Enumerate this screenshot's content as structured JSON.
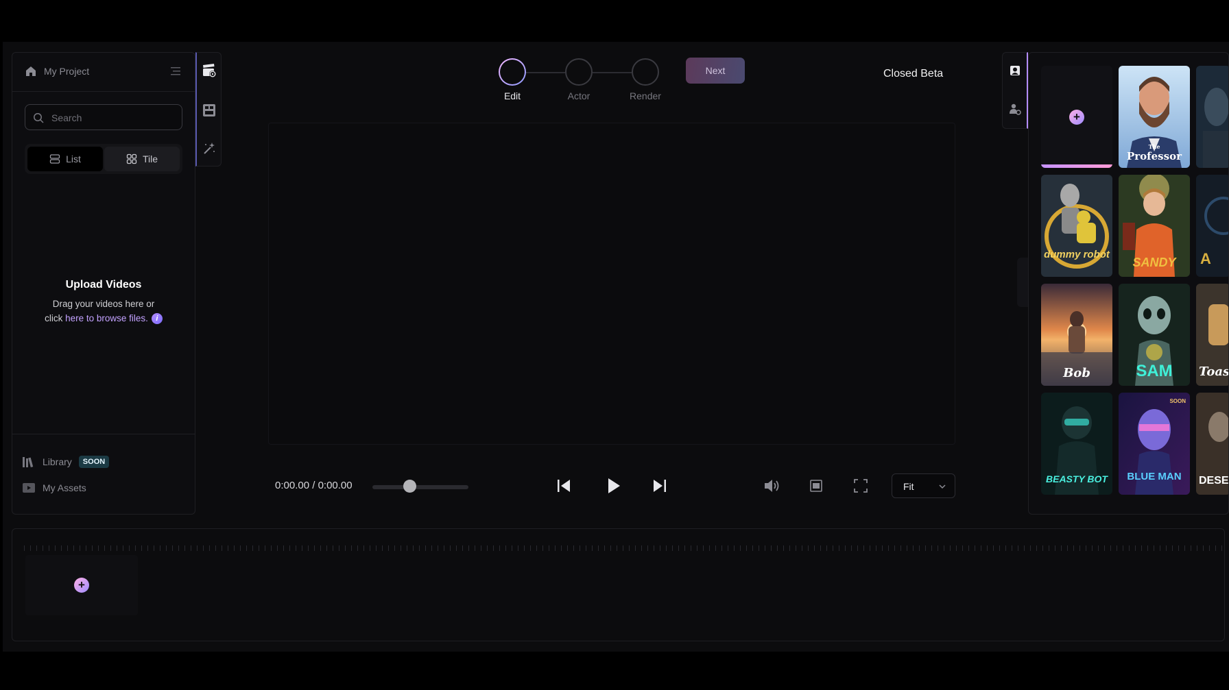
{
  "project": {
    "title": "My Project"
  },
  "search": {
    "placeholder": "Search"
  },
  "view_toggle": {
    "list_label": "List",
    "tile_label": "Tile"
  },
  "upload": {
    "title": "Upload Videos",
    "line1": "Drag your videos here or",
    "line2_prefix": "click ",
    "link_text": "here to browse files.",
    "info_icon": "i"
  },
  "library": {
    "label": "Library",
    "badge": "SOON"
  },
  "assets": {
    "label": "My Assets"
  },
  "stepper": {
    "steps": [
      {
        "label": "Edit",
        "active": true
      },
      {
        "label": "Actor",
        "active": false
      },
      {
        "label": "Render",
        "active": false
      }
    ],
    "next_label": "Next"
  },
  "beta_label": "Closed Beta",
  "player": {
    "current_time": "0:00.00",
    "separator": "/",
    "total_time": "0:00.00",
    "scrub_position": 0.39,
    "fit_value": "Fit"
  },
  "actors": {
    "cards": [
      {
        "name": "The Professor",
        "display_small": "The",
        "display_big": "Professor"
      },
      {
        "name": "dummy robot",
        "display": "dummy robot"
      },
      {
        "name": "SANDY",
        "display": "SANDY"
      },
      {
        "name": "Bob",
        "display": "Bob"
      },
      {
        "name": "SAM",
        "display": "SAM"
      },
      {
        "name": "BEASTY BOT",
        "display": "BEASTY BOT"
      },
      {
        "name": "BLUE MAN",
        "display": "BLUE MAN",
        "tag": "SOON"
      }
    ],
    "partial_cards": [
      {
        "display": "A"
      },
      {
        "display": "Toas"
      },
      {
        "display": "DESE"
      }
    ]
  },
  "colors": {
    "accent_gradient_start": "#f3b6ff",
    "accent_gradient_end": "#8e9bff",
    "badge_bg": "#1b3a44",
    "link": "#c3a2ff"
  },
  "icons": [
    "home-icon",
    "menu-icon",
    "search-icon",
    "list-icon",
    "tile-icon",
    "clapperboard-icon",
    "layout-icon",
    "magic-wand-icon",
    "skip-back-icon",
    "play-icon",
    "skip-forward-icon",
    "volume-icon",
    "aspect-icon",
    "fullscreen-icon",
    "chevron-down-icon",
    "actor-icon",
    "actor-settings-icon",
    "plus-icon"
  ]
}
